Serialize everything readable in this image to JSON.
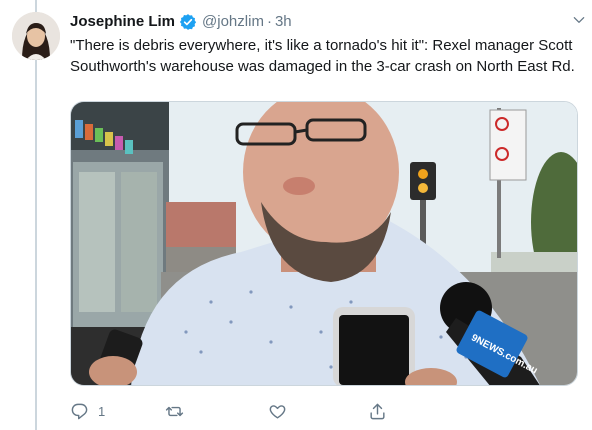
{
  "tweet": {
    "author_name": "Josephine Lim",
    "handle": "@johzlim",
    "separator": "·",
    "time": "3h",
    "text": "\"There is debris everywhere, it's like a tornado's hit it\": Rexel manager Scott Southworth's warehouse was damaged in the 3-car crash on North East Rd.",
    "media_description_icon": "photo",
    "actions": {
      "reply_count": "1",
      "retweet_count": "",
      "like_count": ""
    }
  },
  "media_signs": {
    "news_logo": "9NEWS.com.au"
  },
  "colors": {
    "verified": "#1da1f2",
    "text_secondary": "#657786",
    "divider": "#ccd6dd"
  }
}
